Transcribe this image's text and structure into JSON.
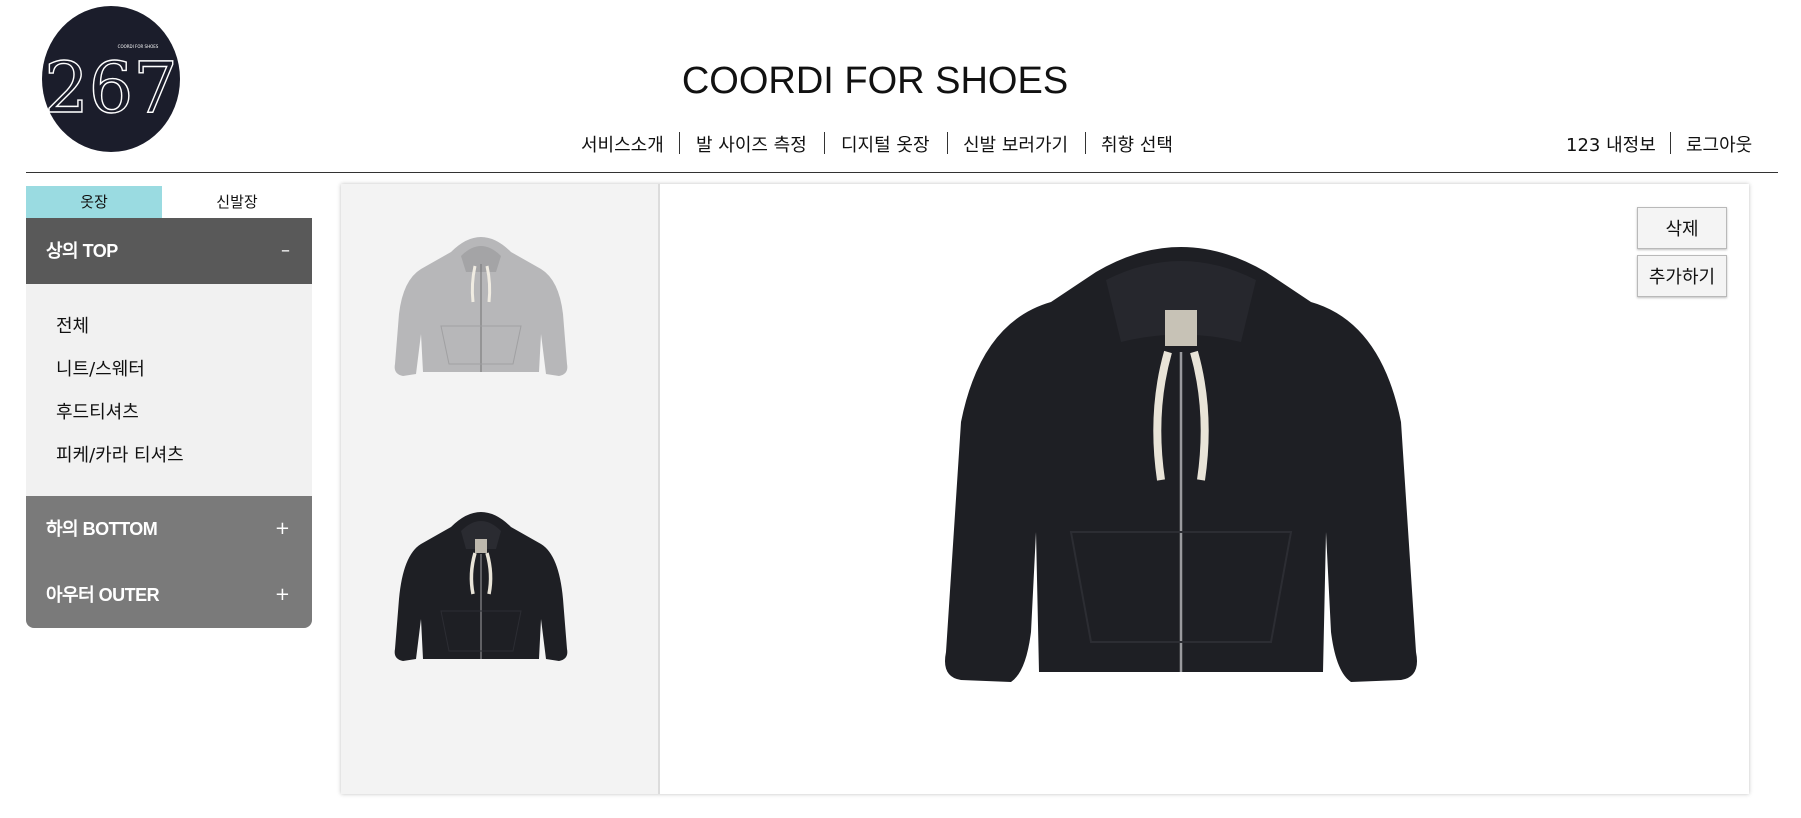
{
  "brand": {
    "logo_text": "267",
    "logo_small_text": "COORDI FOR SHOES",
    "logo_bg_color": "#1b1d2b"
  },
  "header": {
    "title": "COORDI FOR SHOES",
    "nav": [
      {
        "label": "서비스소개"
      },
      {
        "label": "발 사이즈 측정"
      },
      {
        "label": "디지털 옷장"
      },
      {
        "label": "신발 보러가기"
      },
      {
        "label": "취향 선택"
      }
    ],
    "user": {
      "info_label": "123 내정보",
      "logout_label": "로그아웃"
    }
  },
  "sidebar": {
    "tabs": [
      {
        "label": "옷장",
        "active": true
      },
      {
        "label": "신발장",
        "active": false
      }
    ],
    "active_tab_color": "#9adbe1",
    "categories": [
      {
        "label": "상의 TOP",
        "toggle": "–",
        "expanded": true,
        "items": [
          "전체",
          "니트/스웨터",
          "후드티셔츠",
          "피케/카라 티셔츠"
        ]
      },
      {
        "label": "하의 BOTTOM",
        "toggle": "+",
        "expanded": false
      },
      {
        "label": "아우터 OUTER",
        "toggle": "+",
        "expanded": false
      }
    ]
  },
  "closet": {
    "thumbnails": [
      {
        "icon": "gray-zip-hoodie-image",
        "color": "#b7b7b9"
      },
      {
        "icon": "black-zip-hoodie-image",
        "color": "#1e1f24"
      }
    ],
    "selected": {
      "icon": "black-zip-hoodie-image",
      "color": "#1e1f24",
      "drawstring_color": "#e9e4d8"
    },
    "buttons": {
      "delete_label": "삭제",
      "add_label": "추가하기"
    }
  }
}
